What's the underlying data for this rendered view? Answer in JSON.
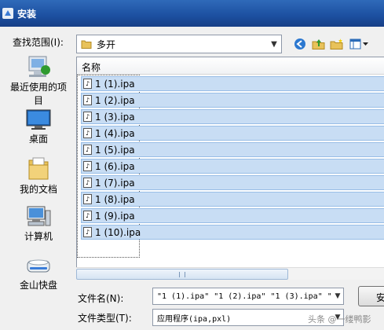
{
  "window": {
    "title": "安装",
    "title_icon": "installer-icon"
  },
  "look_in": {
    "label": "查找范围(I):",
    "value": "多开"
  },
  "toolbar": {
    "icons": [
      "back-icon",
      "up-folder-icon",
      "new-folder-icon",
      "view-menu-icon"
    ]
  },
  "places": [
    {
      "label": "最近使用的项目",
      "icon": "recent-items-icon"
    },
    {
      "label": "桌面",
      "icon": "desktop-icon"
    },
    {
      "label": "我的文档",
      "icon": "my-documents-icon"
    },
    {
      "label": "计算机",
      "icon": "computer-icon"
    },
    {
      "label": "金山快盘",
      "icon": "kuaipan-drive-icon"
    }
  ],
  "file_list": {
    "column_header": "名称",
    "files": [
      "1 (1).ipa",
      "1 (2).ipa",
      "1 (3).ipa",
      "1 (4).ipa",
      "1 (5).ipa",
      "1 (6).ipa",
      "1 (7).ipa",
      "1 (8).ipa",
      "1 (9).ipa",
      "1 (10).ipa"
    ]
  },
  "filename": {
    "label": "文件名(N):",
    "value": "\"1 (1).ipa\" \"1 (2).ipa\" \"1 (3).ipa\" \""
  },
  "filetype": {
    "label": "文件类型(T):",
    "value": "应用程序(ipa,pxl)"
  },
  "open_button": {
    "label": "安"
  },
  "watermark": "头条 @一缕鸭影"
}
